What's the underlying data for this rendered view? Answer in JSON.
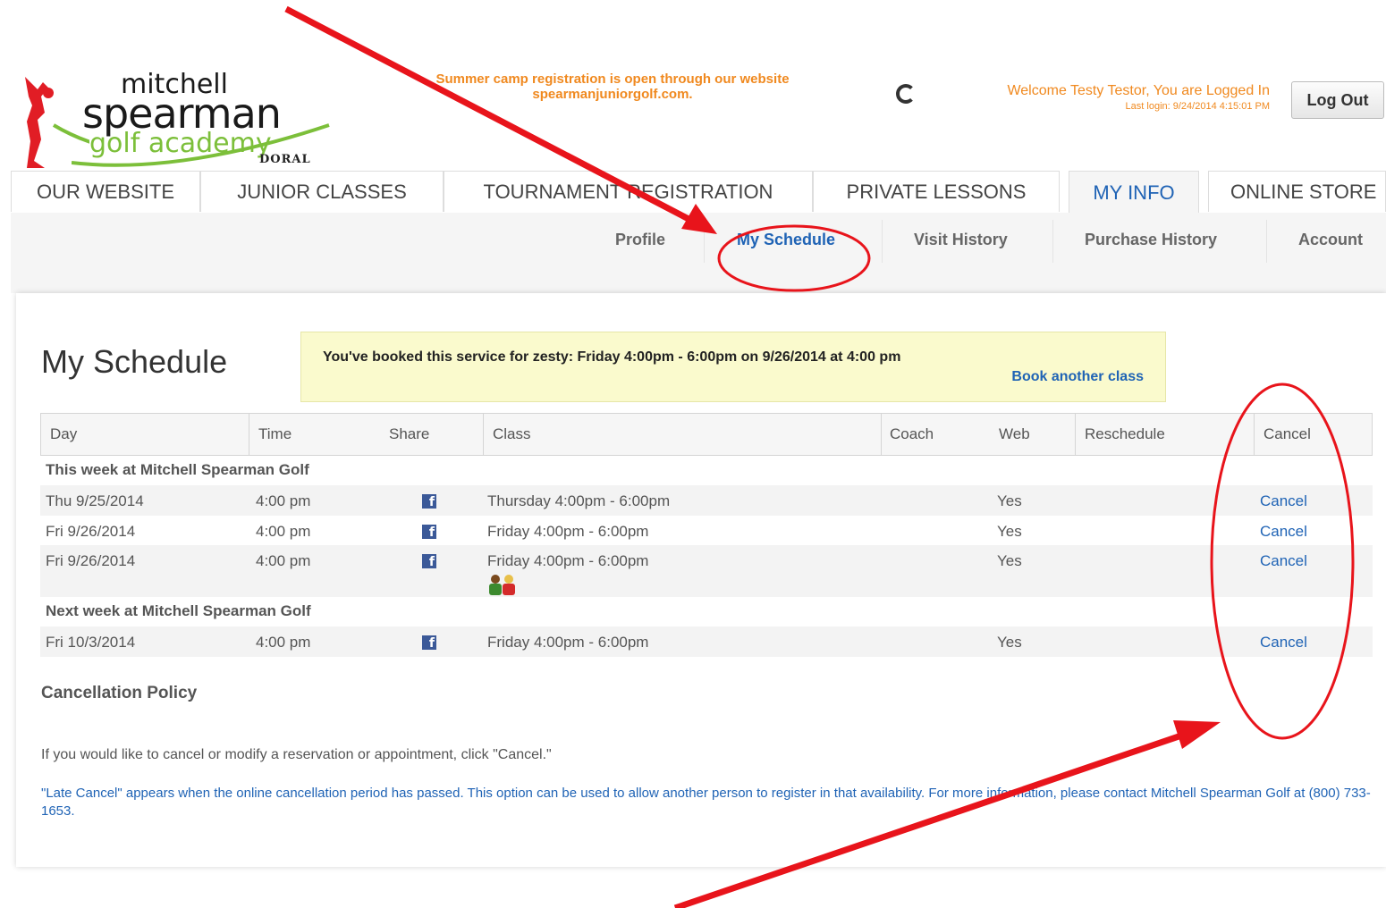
{
  "logo": {
    "line1": "mitchell",
    "line2": "spearman",
    "line3": "golf academy",
    "line4": "DORAL"
  },
  "announcement": {
    "line1": "Summer camp registration is open through our website",
    "line2": "spearmanjuniorgolf.com."
  },
  "welcome": {
    "text": "Welcome Testy Testor, You are Logged In",
    "last_login": "Last login: 9/24/2014 4:15:01 PM"
  },
  "logout_label": "Log Out",
  "main_nav": [
    "OUR WEBSITE",
    "JUNIOR CLASSES",
    "TOURNAMENT REGISTRATION",
    "PRIVATE LESSONS",
    "MY INFO",
    "ONLINE STORE"
  ],
  "main_nav_active": "MY INFO",
  "sub_nav": [
    "Profile",
    "My Schedule",
    "Visit History",
    "Purchase History",
    "Account"
  ],
  "sub_nav_active": "My Schedule",
  "page_title": "My Schedule",
  "notice": {
    "message": "You've booked this service for zesty: Friday 4:00pm - 6:00pm on 9/26/2014 at 4:00 pm",
    "link": "Book another class"
  },
  "table": {
    "columns": [
      "Day",
      "Time",
      "Share",
      "Class",
      "Coach",
      "Web",
      "Reschedule",
      "Cancel"
    ],
    "groups": [
      {
        "title": "This week at Mitchell Spearman Golf",
        "rows": [
          {
            "day": "Thu 9/25/2014",
            "time": "4:00 pm",
            "class": "Thursday 4:00pm - 6:00pm",
            "coach": "",
            "web": "Yes",
            "reschedule": "",
            "cancel": "Cancel"
          },
          {
            "day": "Fri 9/26/2014",
            "time": "4:00 pm",
            "class": "Friday 4:00pm - 6:00pm",
            "coach": "",
            "web": "Yes",
            "reschedule": "",
            "cancel": "Cancel"
          },
          {
            "day": "Fri 9/26/2014",
            "time": "4:00 pm",
            "class": "Friday 4:00pm - 6:00pm",
            "coach": "",
            "web": "Yes",
            "reschedule": "",
            "cancel": "Cancel",
            "people_icon": true
          }
        ]
      },
      {
        "title": "Next week at Mitchell Spearman Golf",
        "rows": [
          {
            "day": "Fri 10/3/2014",
            "time": "4:00 pm",
            "class": "Friday 4:00pm - 6:00pm",
            "coach": "",
            "web": "Yes",
            "reschedule": "",
            "cancel": "Cancel"
          }
        ]
      }
    ]
  },
  "policy": {
    "title": "Cancellation Policy",
    "line1": "If you would like to cancel or modify a reservation or appointment, click \"Cancel.\"",
    "line2": "\"Late Cancel\" appears when the online cancellation period has passed. This option can be used to allow another person to register in that availability. For more information, please contact Mitchell Spearman Golf at (800) 733-1653."
  },
  "colors": {
    "accent": "#1f63b5",
    "announcement": "#f0891f",
    "notice_bg": "#fafacd",
    "annotation": "#e8141b",
    "facebook": "#3b5998"
  }
}
